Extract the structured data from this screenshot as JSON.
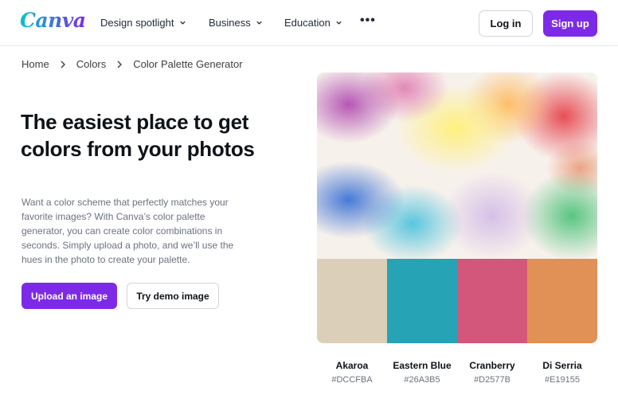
{
  "header": {
    "logo": "Canva",
    "nav": [
      {
        "label": "Design spotlight"
      },
      {
        "label": "Business"
      },
      {
        "label": "Education"
      }
    ],
    "more_label": "•••",
    "login_label": "Log in",
    "signup_label": "Sign up"
  },
  "breadcrumb": [
    "Home",
    "Colors",
    "Color Palette Generator"
  ],
  "hero": {
    "title": "The easiest place to get colors from your photos",
    "description": "Want a color scheme that perfectly matches your favorite images? With Canva’s color palette generator, you can create color combinations in seconds. Simply upload a photo, and we’ll use the hues in the photo to create your palette.",
    "upload_label": "Upload an image",
    "demo_label": "Try demo image"
  },
  "palette": [
    {
      "name": "Akaroa",
      "hex": "#DCCFBA"
    },
    {
      "name": "Eastern Blue",
      "hex": "#26A3B5"
    },
    {
      "name": "Cranberry",
      "hex": "#D2577B"
    },
    {
      "name": "Di Serria",
      "hex": "#E19155"
    }
  ],
  "colors": {
    "brand_purple": "#7d2ae8",
    "logo_gradient_start": "#00c4cc",
    "logo_gradient_end": "#7d2ae8"
  }
}
